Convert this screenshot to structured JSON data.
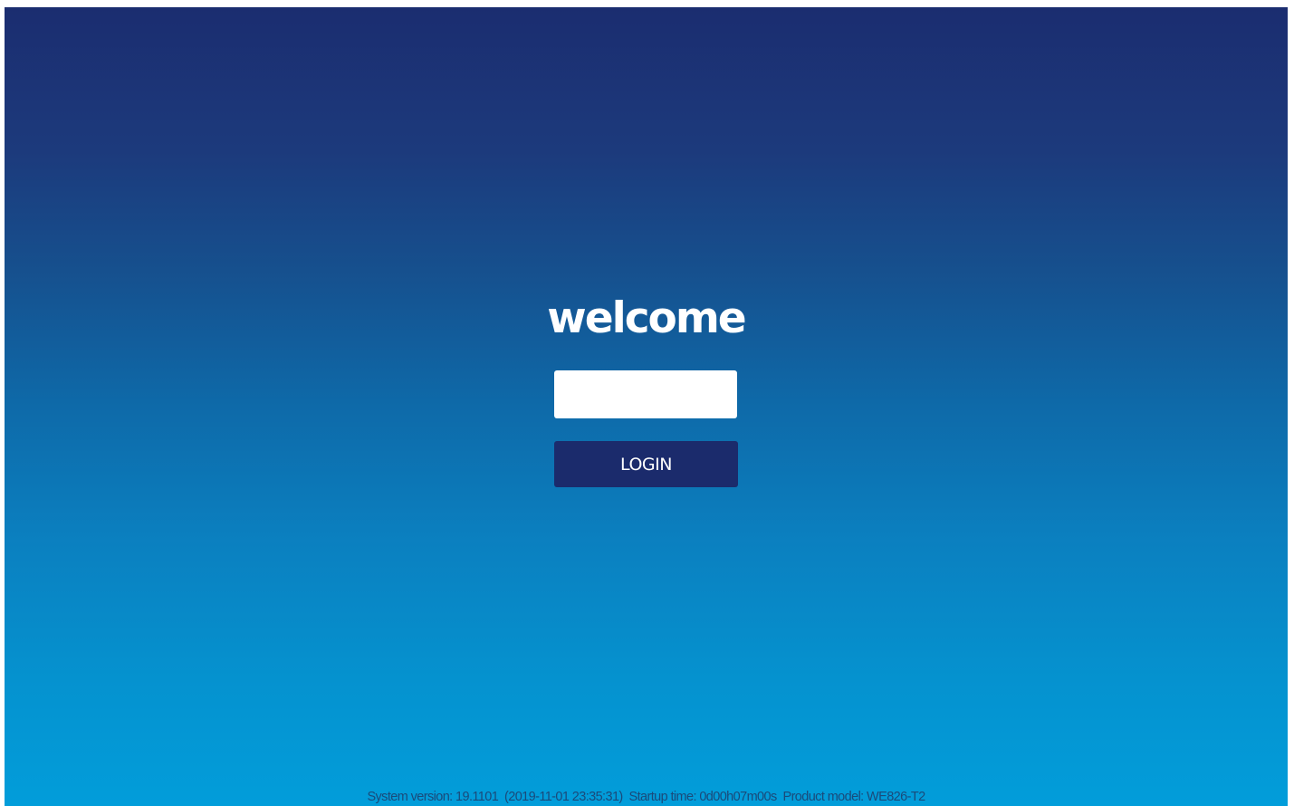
{
  "login": {
    "welcome_text": "welcome",
    "input_value": "",
    "input_placeholder": "",
    "button_label": "LOGIN"
  },
  "footer": {
    "system_info": "System version: 19.1101  (2019-11-01 23:35:31)  Startup time: 0d00h07m00s  Product model: WE826-T2"
  },
  "colors": {
    "background_top": "#1b2d70",
    "background_bottom": "#029dda",
    "button": "#1b2b6c",
    "input": "#ffffff",
    "text": "#ffffff"
  }
}
